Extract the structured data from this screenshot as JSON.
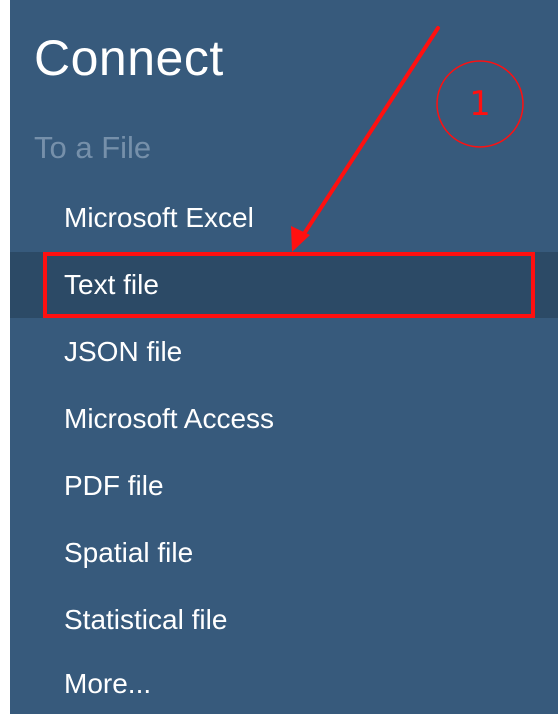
{
  "header": {
    "title": "Connect"
  },
  "section": {
    "header": "To a File"
  },
  "menu": {
    "items": [
      {
        "label": "Microsoft Excel",
        "selected": false
      },
      {
        "label": "Text file",
        "selected": true
      },
      {
        "label": "JSON file",
        "selected": false
      },
      {
        "label": "Microsoft Access",
        "selected": false
      },
      {
        "label": "PDF file",
        "selected": false
      },
      {
        "label": "Spatial file",
        "selected": false
      },
      {
        "label": "Statistical file",
        "selected": false
      },
      {
        "label": "More...",
        "selected": false
      }
    ]
  },
  "annotation": {
    "step_number": "1",
    "color": "#ff1010"
  },
  "colors": {
    "panel_background": "#375a7c",
    "selected_background": "#2c4a66",
    "section_header_text": "#7690aa",
    "item_text": "#ffffff"
  }
}
